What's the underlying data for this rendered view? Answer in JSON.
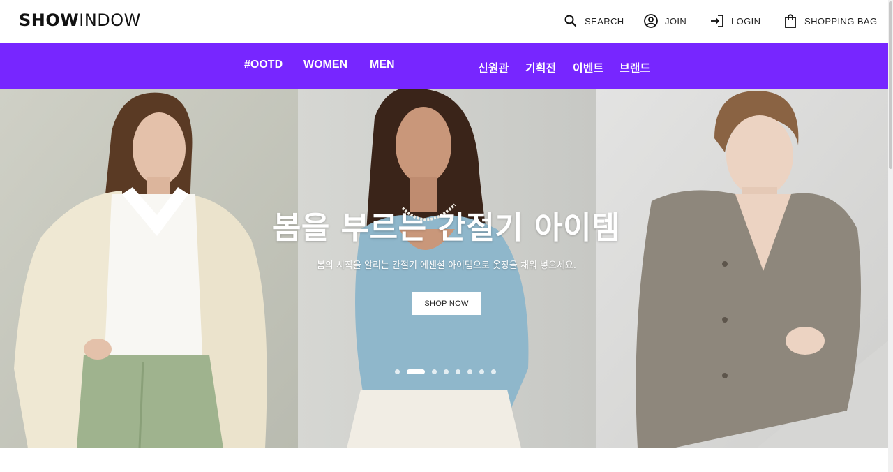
{
  "header": {
    "logo": {
      "part1": "SHOW",
      "part2": "INDOW"
    },
    "utilities": {
      "search": {
        "label": "SEARCH",
        "icon": "search-icon"
      },
      "join": {
        "label": "JOIN",
        "icon": "user-circle-icon"
      },
      "login": {
        "label": "LOGIN",
        "icon": "login-arrow-icon"
      },
      "bag": {
        "label": "SHOPPING BAG",
        "icon": "shopping-bag-icon"
      }
    }
  },
  "nav": {
    "bg_color": "#7726ff",
    "primary": [
      "#OOTD",
      "WOMEN",
      "MEN"
    ],
    "secondary": [
      "신원관",
      "기획전",
      "이벤트",
      "브랜드"
    ]
  },
  "hero": {
    "title": "봄을 부르는 간절기 아이템",
    "subtitle": "봄의 시작을 알리는 간절기 에센셜 아이템으로 옷장을 채워 넣으세요.",
    "cta": "SHOP NOW",
    "slide_count": 8,
    "active_slide": 2
  }
}
